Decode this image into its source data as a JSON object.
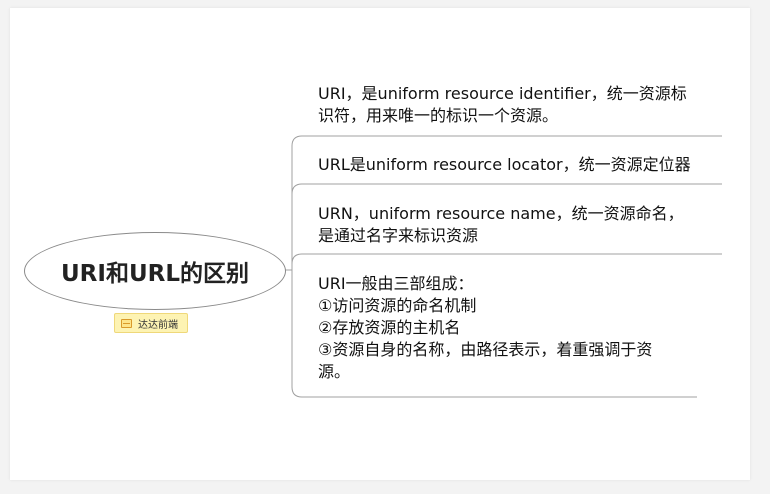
{
  "root": {
    "title": "URI和URL的区别"
  },
  "tag": {
    "label": "达达前端",
    "icon": "note-icon"
  },
  "branches": [
    {
      "lines": [
        "URI，是uniform resource identifier，统一资源标",
        "识符，用来唯一的标识一个资源。"
      ]
    },
    {
      "lines": [
        "URL是uniform resource locator，统一资源定位器"
      ]
    },
    {
      "lines": [
        "URN，uniform resource name，统一资源命名，",
        "是通过名字来标识资源"
      ]
    },
    {
      "lines": [
        "URI一般由三部组成：",
        "①访问资源的命名机制",
        "②存放资源的主机名",
        "③资源自身的名称，由路径表示，着重强调于资",
        "源。"
      ]
    }
  ],
  "colors": {
    "connector": "#9a9a9a",
    "tag_bg": "#fdf3b3",
    "background": "#ffffff"
  }
}
